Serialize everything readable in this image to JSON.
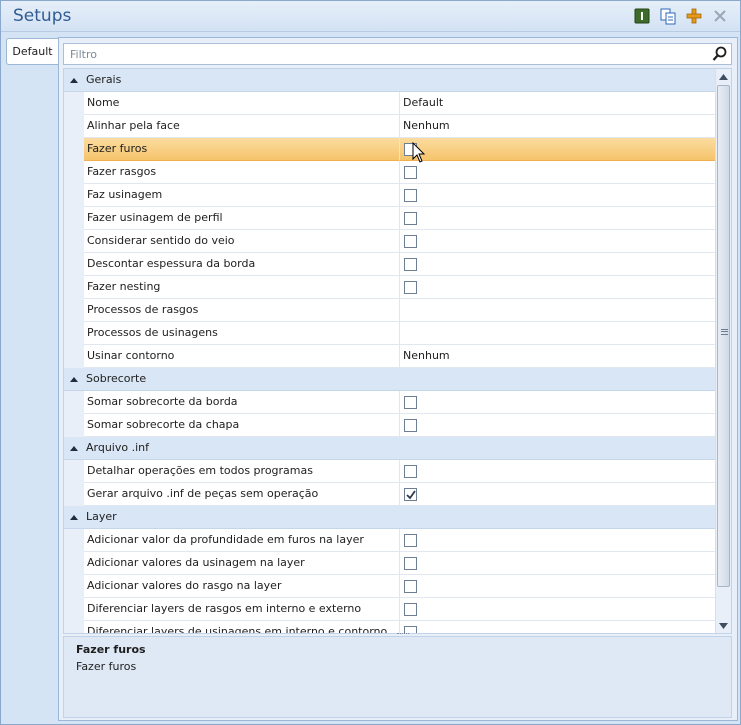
{
  "window": {
    "title": "Setups",
    "toolbar": [
      {
        "name": "info-icon",
        "color": "#3d6b2a"
      },
      {
        "name": "copy-icon",
        "color": "#2f67b8"
      },
      {
        "name": "add-icon",
        "color": "#e59a1c"
      },
      {
        "name": "close-icon",
        "color": "#9aa7b6"
      }
    ]
  },
  "tabs": {
    "default_label": "Default"
  },
  "filter": {
    "placeholder": "Filtro",
    "value": ""
  },
  "grid": {
    "categories": [
      {
        "label": "Gerais",
        "rows": [
          {
            "name": "Nome",
            "type": "text",
            "value": "Default"
          },
          {
            "name": "Alinhar pela face",
            "type": "text",
            "value": "Nenhum"
          },
          {
            "name": "Fazer furos",
            "type": "checkbox",
            "checked": false,
            "selected": true
          },
          {
            "name": "Fazer rasgos",
            "type": "checkbox",
            "checked": false
          },
          {
            "name": "Faz usinagem",
            "type": "checkbox",
            "checked": false
          },
          {
            "name": "Fazer usinagem de perfil",
            "type": "checkbox",
            "checked": false
          },
          {
            "name": "Considerar sentido do veio",
            "type": "checkbox",
            "checked": false
          },
          {
            "name": "Descontar espessura da borda",
            "type": "checkbox",
            "checked": false
          },
          {
            "name": "Fazer nesting",
            "type": "checkbox",
            "checked": false
          },
          {
            "name": "Processos de rasgos",
            "type": "text",
            "value": ""
          },
          {
            "name": "Processos de usinagens",
            "type": "text",
            "value": ""
          },
          {
            "name": "Usinar contorno",
            "type": "text",
            "value": "Nenhum"
          }
        ]
      },
      {
        "label": "Sobrecorte",
        "rows": [
          {
            "name": "Somar sobrecorte da borda",
            "type": "checkbox",
            "checked": false
          },
          {
            "name": "Somar sobrecorte da chapa",
            "type": "checkbox",
            "checked": false
          }
        ]
      },
      {
        "label": "Arquivo .inf",
        "rows": [
          {
            "name": "Detalhar operações em todos programas",
            "type": "checkbox",
            "checked": false
          },
          {
            "name": "Gerar arquivo .inf de peças sem operação",
            "type": "checkbox",
            "checked": true
          }
        ]
      },
      {
        "label": "Layer",
        "rows": [
          {
            "name": "Adicionar valor da profundidade em furos na layer",
            "type": "checkbox",
            "checked": false
          },
          {
            "name": "Adicionar valores da usinagem na layer",
            "type": "checkbox",
            "checked": false
          },
          {
            "name": "Adicionar valores do rasgo na layer",
            "type": "checkbox",
            "checked": false
          },
          {
            "name": "Diferenciar layers de rasgos em interno e externo",
            "type": "checkbox",
            "checked": false
          },
          {
            "name": "Diferenciar layers de usinagens em interno e contorno",
            "type": "checkbox",
            "checked": false
          }
        ]
      }
    ]
  },
  "description": {
    "title": "Fazer furos",
    "text": "Fazer furos"
  },
  "colors": {
    "selection": "#f5c46b",
    "category_bg": "#d9e6f5",
    "title_text": "#2f5d92"
  }
}
